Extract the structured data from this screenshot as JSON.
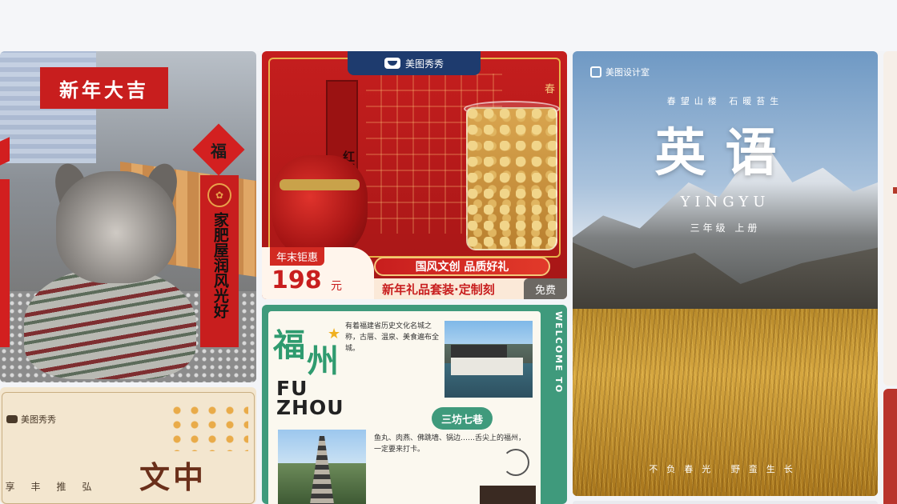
{
  "cards": {
    "dog": {
      "badge": "新年大吉",
      "fu": "福",
      "banner": "家肥屋润风光好"
    },
    "gift": {
      "brand": "美图秀秀",
      "scroll": "红梅糕",
      "corner": "春",
      "promo_label": "年末钜惠",
      "price": "198",
      "price_unit": "元",
      "pill": "国风文创 品质好礼",
      "subtitle": "新年礼品套装·定制刻",
      "free_badge": "免费"
    },
    "fuzhou": {
      "welcome": "WELCOME TO",
      "title_a": "福",
      "title_b": "州",
      "en_a": "FU",
      "en_b": "ZHOU",
      "intro": "有着福建省历史文化名城之称，古厝、温泉、美食遍布全城。",
      "tag": "三坊七巷",
      "notes": "鱼丸、肉燕、佛跳墙、锅边……舌尖上的福州，一定要来打卡。"
    },
    "english": {
      "brand": "美图设计室",
      "tagline": "春望山楼 石暖苔生",
      "title": "英语",
      "pinyin": "YINGYU",
      "grade": "三年级 上册",
      "bottom": "不负春光 野蛮生长"
    },
    "culture": {
      "brand": "美图秀秀",
      "big": "文中",
      "cols": [
        "享",
        "丰",
        "推",
        "弘"
      ]
    }
  }
}
